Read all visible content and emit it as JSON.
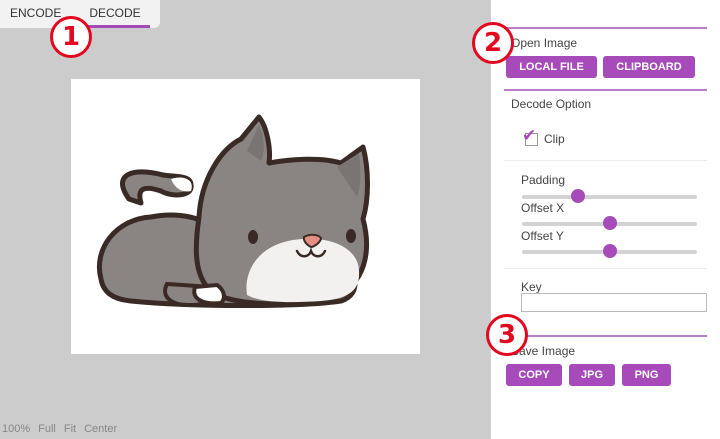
{
  "tabs": [
    {
      "label": "ENCODE",
      "active": false
    },
    {
      "label": "DECODE",
      "active": true
    }
  ],
  "zoom_options": [
    "100%",
    "Full",
    "Fit",
    "Center"
  ],
  "badges": [
    "1",
    "2",
    "3"
  ],
  "open_image": {
    "title": "Open Image",
    "local_file_label": "LOCAL FILE",
    "clipboard_label": "CLIPBOARD"
  },
  "decode_option": {
    "title": "Decode Option",
    "clip_label": "Clip",
    "clip_checked": true,
    "padding_label": "Padding",
    "padding_value": 0.32,
    "offset_x_label": "Offset X",
    "offset_x_value": 0.5,
    "offset_y_label": "Offset Y",
    "offset_y_value": 0.5,
    "key_label": "Key",
    "key_value": "",
    "key_placeholder": ""
  },
  "save_image": {
    "title": "Save Image",
    "copy_label": "COPY",
    "jpg_label": "JPG",
    "png_label": "PNG"
  },
  "colors": {
    "accent": "#a64bb9",
    "canvas_bg": "#cccccc",
    "badge_red": "#e3081f",
    "cat_gray": "#8a8583",
    "outline": "#3a2a26"
  }
}
